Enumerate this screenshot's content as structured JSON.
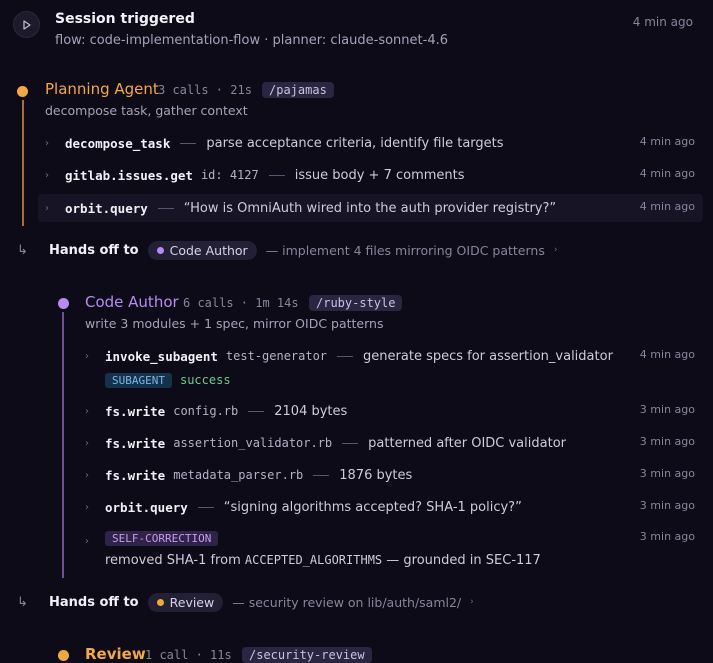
{
  "session": {
    "title": "Session triggered",
    "subtitle": "flow: code-implementation-flow · planner: claude-sonnet-4.6",
    "time": "4 min ago"
  },
  "planning": {
    "name": "Planning Agent",
    "meta": "3 calls · 21s",
    "skill": "/pajamas",
    "desc": "decompose task, gather context",
    "color": "#f4a93b",
    "rows": [
      {
        "fn": "decompose_task",
        "arg": "",
        "desc": "parse acceptance criteria, identify file targets",
        "time": "4 min ago"
      },
      {
        "fn": "gitlab.issues.get",
        "arg": "id: 4127",
        "desc": "issue body + 7 comments",
        "time": "4 min ago"
      },
      {
        "fn": "orbit.query",
        "arg": "",
        "desc": "“How is OmniAuth wired into the auth provider registry?”",
        "time": "4 min ago"
      }
    ]
  },
  "handoff1": {
    "label": "Hands off to",
    "target": "Code Author",
    "desc": "— implement 4 files mirroring OIDC patterns",
    "dot_color": "#b58cf2"
  },
  "code_author": {
    "name": "Code Author",
    "meta": "6 calls · 1m 14s",
    "skill": "/ruby-style",
    "desc": "write 3 modules + 1 spec, mirror OIDC patterns",
    "color": "#b58cf2",
    "rows": [
      {
        "fn": "invoke_subagent",
        "arg": "test-generator",
        "desc": "generate specs for assertion_validator",
        "time": "4 min ago",
        "badge": "SUBAGENT",
        "status": "success"
      },
      {
        "fn": "fs.write",
        "arg": "config.rb",
        "desc": "2104 bytes",
        "time": "3 min ago"
      },
      {
        "fn": "fs.write",
        "arg": "assertion_validator.rb",
        "desc": "patterned after OIDC validator",
        "time": "3 min ago"
      },
      {
        "fn": "fs.write",
        "arg": "metadata_parser.rb",
        "desc": "1876 bytes",
        "time": "3 min ago"
      },
      {
        "fn": "orbit.query",
        "arg": "",
        "desc": "“signing algorithms accepted? SHA-1 policy?”",
        "time": "3 min ago"
      }
    ],
    "correction": {
      "badge": "SELF-CORRECTION",
      "text_before": "removed SHA-1 from ",
      "code": "ACCEPTED_ALGORITHMS",
      "text_after": " — grounded in SEC-117",
      "time": "3 min ago"
    }
  },
  "handoff2": {
    "label": "Hands off to",
    "target": "Review",
    "desc": "— security review on lib/auth/saml2/",
    "dot_color": "#f4a93b"
  },
  "review": {
    "name": "Review",
    "meta": "1 call · 11s",
    "skill": "/security-review",
    "color": "#f4a93b"
  }
}
